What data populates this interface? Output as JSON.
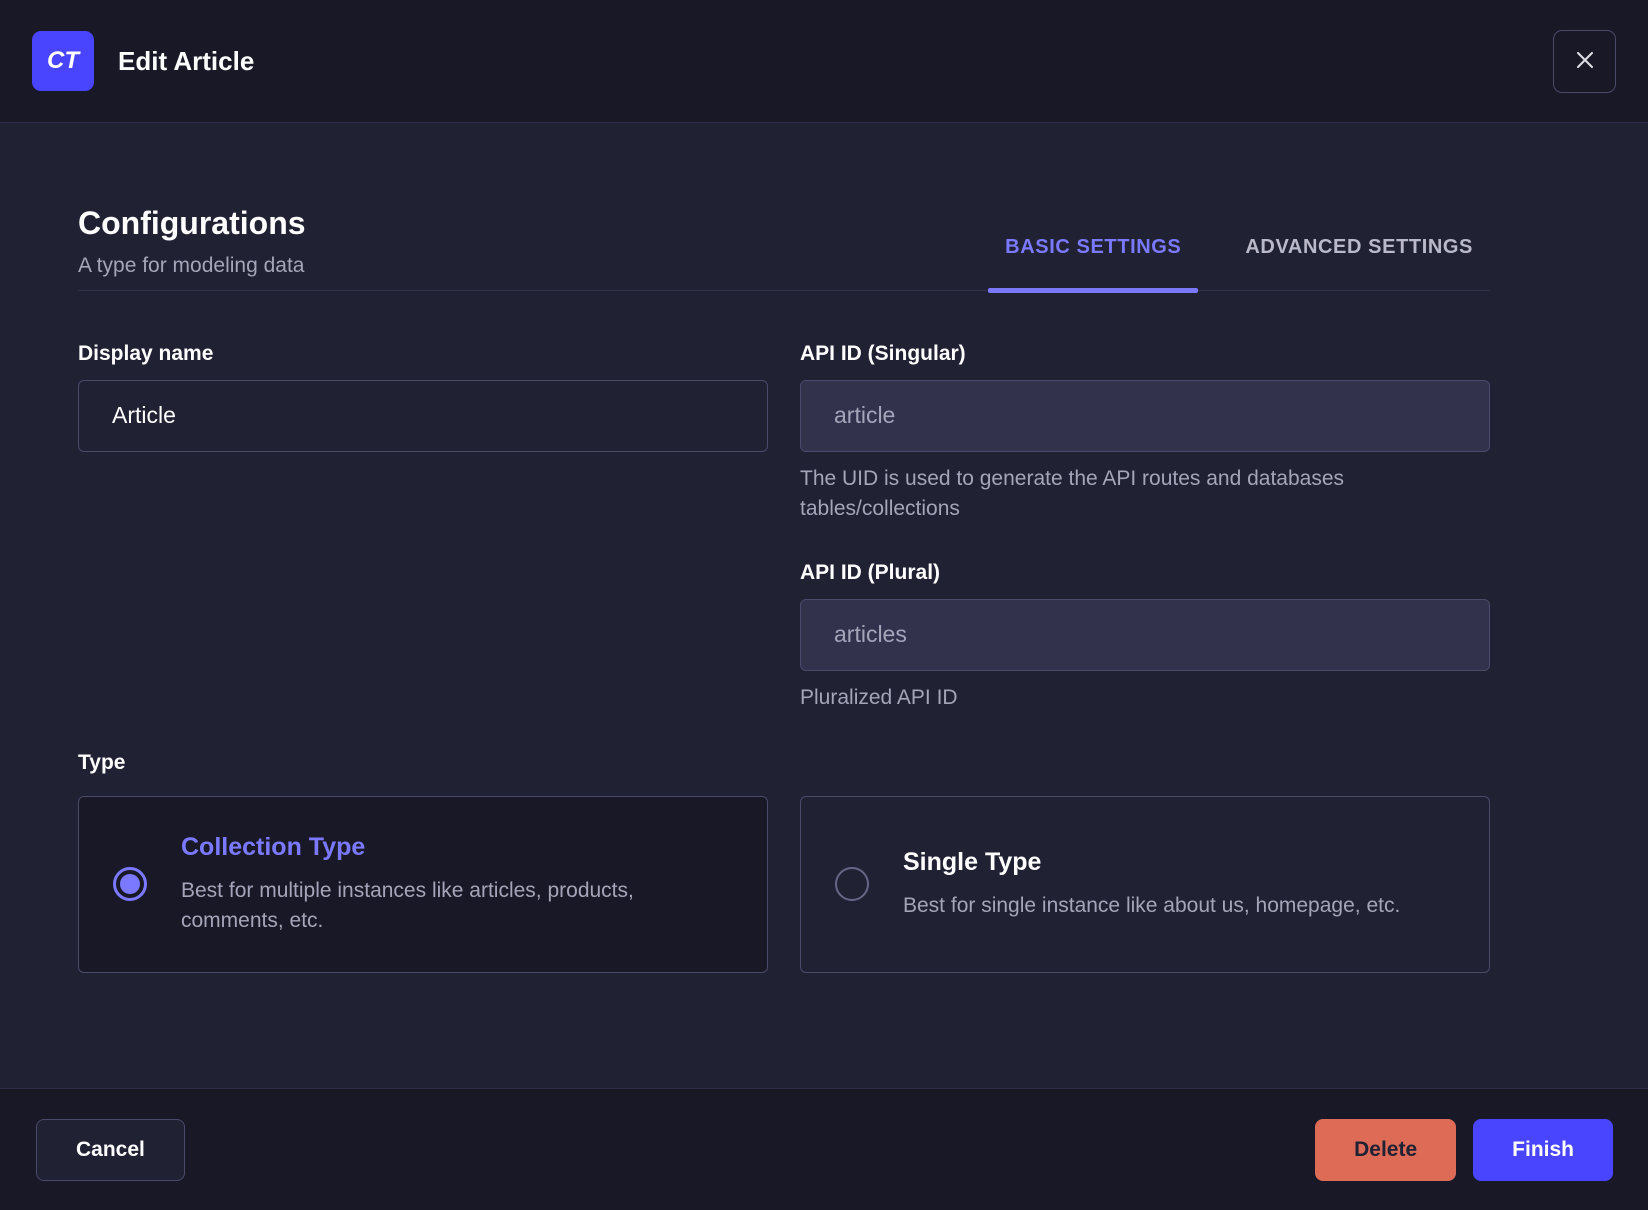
{
  "colors": {
    "primary": "#4945ff",
    "primary_light": "#7b79ff",
    "danger": "#dd6b56",
    "header_bg": "#181826",
    "body_bg": "#212134",
    "border": "#4a4a6a",
    "muted_text": "#a5a5ba"
  },
  "header": {
    "badge": "CT",
    "title": "Edit Article",
    "close_icon": "close-icon"
  },
  "body": {
    "section_title": "Configurations",
    "section_subtitle": "A type for modeling data",
    "tabs": [
      {
        "label": "BASIC SETTINGS",
        "active": true
      },
      {
        "label": "ADVANCED SETTINGS",
        "active": false
      }
    ],
    "fields": {
      "display_name": {
        "label": "Display name",
        "value": "Article"
      },
      "api_id_singular": {
        "label": "API ID (Singular)",
        "value": "article",
        "hint": "The UID is used to generate the API routes and databases tables/collections"
      },
      "api_id_plural": {
        "label": "API ID (Plural)",
        "value": "articles",
        "hint": "Pluralized API ID"
      }
    },
    "type": {
      "label": "Type",
      "options": [
        {
          "title": "Collection Type",
          "description": "Best for multiple instances like articles, products, comments, etc.",
          "selected": true
        },
        {
          "title": "Single Type",
          "description": "Best for single instance like about us, homepage, etc.",
          "selected": false
        }
      ]
    }
  },
  "footer": {
    "cancel_label": "Cancel",
    "delete_label": "Delete",
    "finish_label": "Finish"
  }
}
